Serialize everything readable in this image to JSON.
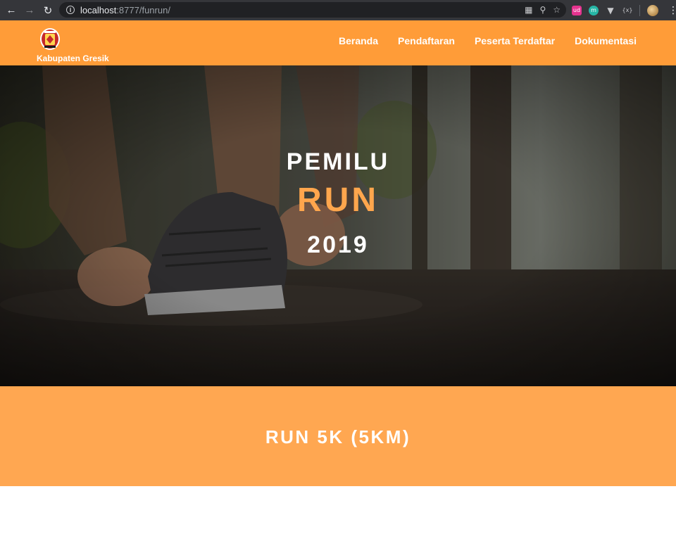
{
  "browser": {
    "url_host": "localhost",
    "url_path": ":8777/funrun/",
    "icons": [
      "back-icon",
      "forward-icon",
      "reload-icon",
      "info-icon",
      "translate-icon",
      "zoom-icon",
      "star-icon",
      "menu-dots-icon"
    ]
  },
  "navbar": {
    "brand": "Kabupaten Gresik",
    "menu": [
      {
        "label": "Beranda"
      },
      {
        "label": "Pendaftaran"
      },
      {
        "label": "Peserta Terdaftar"
      },
      {
        "label": "Dokumentasi"
      }
    ],
    "color": "#ff9c38"
  },
  "hero": {
    "line1": "PEMILU",
    "line2": "RUN",
    "line3": "2019",
    "accent": "#ffa64d"
  },
  "section": {
    "title": "RUN 5K (5KM)",
    "color": "#ffa751"
  }
}
